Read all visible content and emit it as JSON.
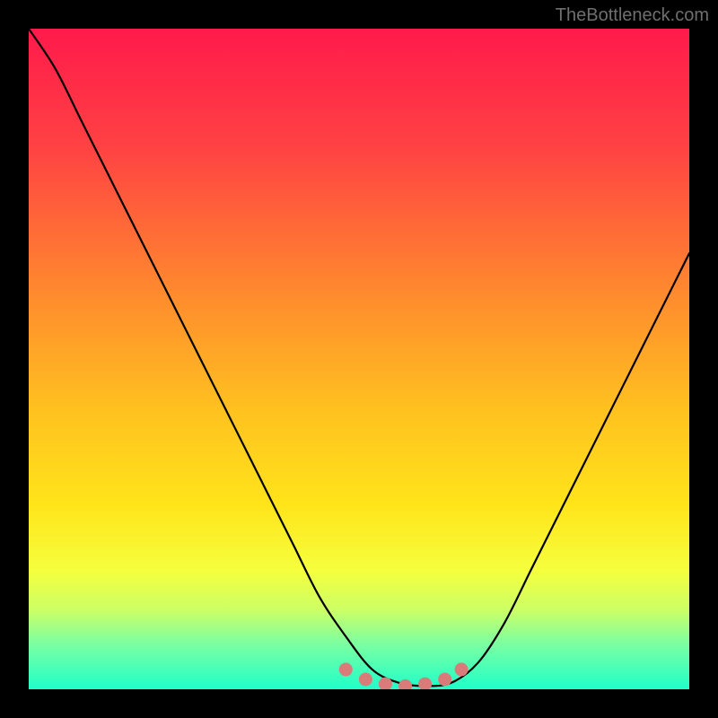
{
  "watermark": "TheBottleneck.com",
  "chart_data": {
    "type": "line",
    "title": "",
    "xlabel": "",
    "ylabel": "",
    "xlim": [
      0,
      100
    ],
    "ylim": [
      0,
      100
    ],
    "gradient_stops": [
      {
        "offset": 0,
        "color": "#ff1a4b"
      },
      {
        "offset": 18,
        "color": "#ff4243"
      },
      {
        "offset": 40,
        "color": "#ff8a2e"
      },
      {
        "offset": 58,
        "color": "#ffc21f"
      },
      {
        "offset": 72,
        "color": "#ffe41a"
      },
      {
        "offset": 82,
        "color": "#f5ff3d"
      },
      {
        "offset": 88,
        "color": "#ccff66"
      },
      {
        "offset": 93,
        "color": "#7dffa0"
      },
      {
        "offset": 100,
        "color": "#1fffc9"
      }
    ],
    "series": [
      {
        "name": "bottleneck-curve",
        "color": "#000000",
        "x": [
          0,
          4,
          8,
          12,
          16,
          20,
          24,
          28,
          32,
          36,
          40,
          44,
          48,
          52,
          56,
          60,
          64,
          68,
          72,
          76,
          80,
          84,
          88,
          92,
          96,
          100
        ],
        "y": [
          100,
          94,
          86,
          78,
          70,
          62,
          54,
          46,
          38,
          30,
          22,
          14,
          8,
          3,
          1,
          0.5,
          1,
          4,
          10,
          18,
          26,
          34,
          42,
          50,
          58,
          66
        ]
      },
      {
        "name": "optimal-range-dots",
        "color": "#d87b79",
        "type": "scatter",
        "x": [
          48,
          51,
          54,
          57,
          60,
          63,
          65.5
        ],
        "y": [
          3,
          1.5,
          0.8,
          0.5,
          0.8,
          1.5,
          3
        ]
      }
    ],
    "annotations": []
  }
}
